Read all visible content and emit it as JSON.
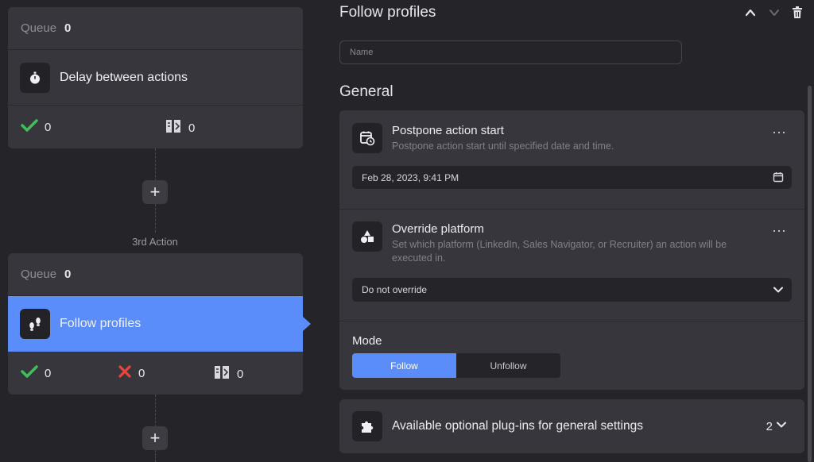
{
  "workflow": {
    "card1": {
      "queue_label": "Queue",
      "queue_count": "0",
      "action_label": "Delay between actions",
      "success_count": "0",
      "skipped_count": "0"
    },
    "step_label": "3rd Action",
    "card2": {
      "queue_label": "Queue",
      "queue_count": "0",
      "action_label": "Follow profiles",
      "success_count": "0",
      "failed_count": "0",
      "skipped_count": "0"
    },
    "add_label": "+"
  },
  "panel": {
    "title": "Follow profiles",
    "name_placeholder": "Name",
    "general_title": "General",
    "postpone": {
      "title": "Postpone action start",
      "description": "Postpone action start until specified date and time.",
      "value": "Feb 28, 2023, 9:41 PM",
      "menu": "⋯"
    },
    "override": {
      "title": "Override platform",
      "description": "Set which platform (LinkedIn, Sales Navigator, or Recruiter) an action will be executed in.",
      "value": "Do not override",
      "menu": "⋯"
    },
    "mode": {
      "label": "Mode",
      "options": [
        "Follow",
        "Unfollow"
      ],
      "selected": "Follow"
    },
    "plugins": {
      "title": "Available optional plug-ins for general settings",
      "count": "2"
    }
  },
  "colors": {
    "accent": "#5b8dfa",
    "success": "#3fbf5a",
    "error": "#e8453c",
    "background": "#252529",
    "card": "#36363c"
  },
  "icons": [
    "stopwatch-icon",
    "check-icon",
    "cross-icon",
    "skip-list-icon",
    "footsteps-icon",
    "chevron-up-icon",
    "chevron-down-icon",
    "trash-icon",
    "calendar-clock-icon",
    "calendar-icon",
    "shapes-icon",
    "puzzle-icon"
  ]
}
